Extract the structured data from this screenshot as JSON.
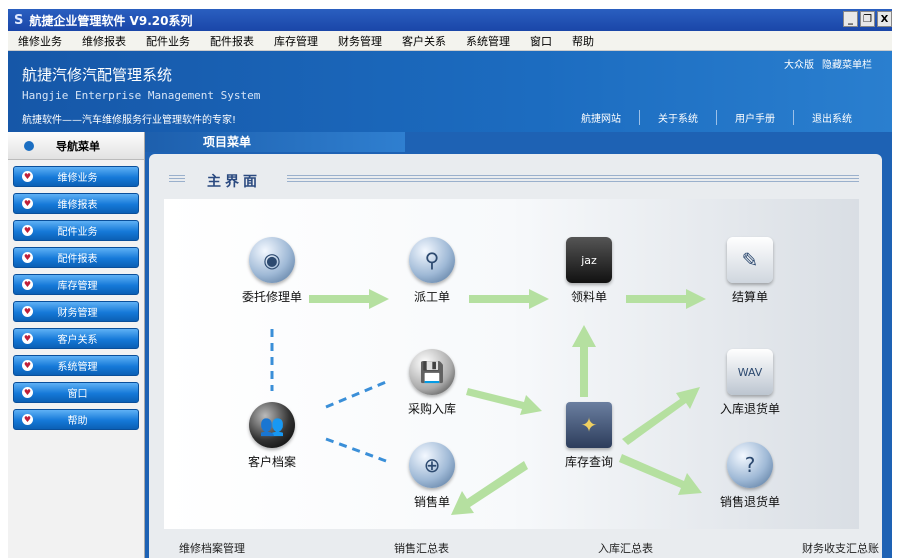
{
  "window": {
    "title": "航捷企业管理软件 V9.20系列",
    "min": "_",
    "restore": "❐",
    "close": "X"
  },
  "menu": [
    "维修业务",
    "维修报表",
    "配件业务",
    "配件报表",
    "库存管理",
    "财务管理",
    "客户关系",
    "系统管理",
    "窗口",
    "帮助"
  ],
  "banner": {
    "title": "航捷汽修汽配管理系统",
    "subtitle": "Hangjie Enterprise Management System",
    "slogan": "航捷软件——汽车维修服务行业管理软件的专家!",
    "edition": "大众版",
    "hide_menu": "隐藏菜单栏",
    "links": [
      "航捷网站",
      "关于系统",
      "用户手册",
      "退出系统"
    ]
  },
  "sidebar": {
    "title": "导航菜单",
    "items": [
      "维修业务",
      "维修报表",
      "配件业务",
      "配件报表",
      "库存管理",
      "财务管理",
      "客户关系",
      "系统管理",
      "窗口",
      "帮助"
    ]
  },
  "main": {
    "tab": "项目菜单",
    "title": "主界面",
    "nodes": {
      "weituo": "委托修理单",
      "paigong": "派工单",
      "lingliao": "领料单",
      "jiesuan": "结算单",
      "caigou": "采购入库",
      "kehu": "客户档案",
      "kucun": "库存查询",
      "xiaoshou": "销售单",
      "rukutuihuo": "入库退货单",
      "xiaoshoutuihuo": "销售退货单"
    },
    "bottom": [
      "维修档案管理",
      "销售汇总表",
      "入库汇总表",
      "财务收支汇总账"
    ]
  },
  "colors": {
    "accent": "#1579d8",
    "arrow": "#a8d890",
    "dash": "#3a8fd8"
  }
}
